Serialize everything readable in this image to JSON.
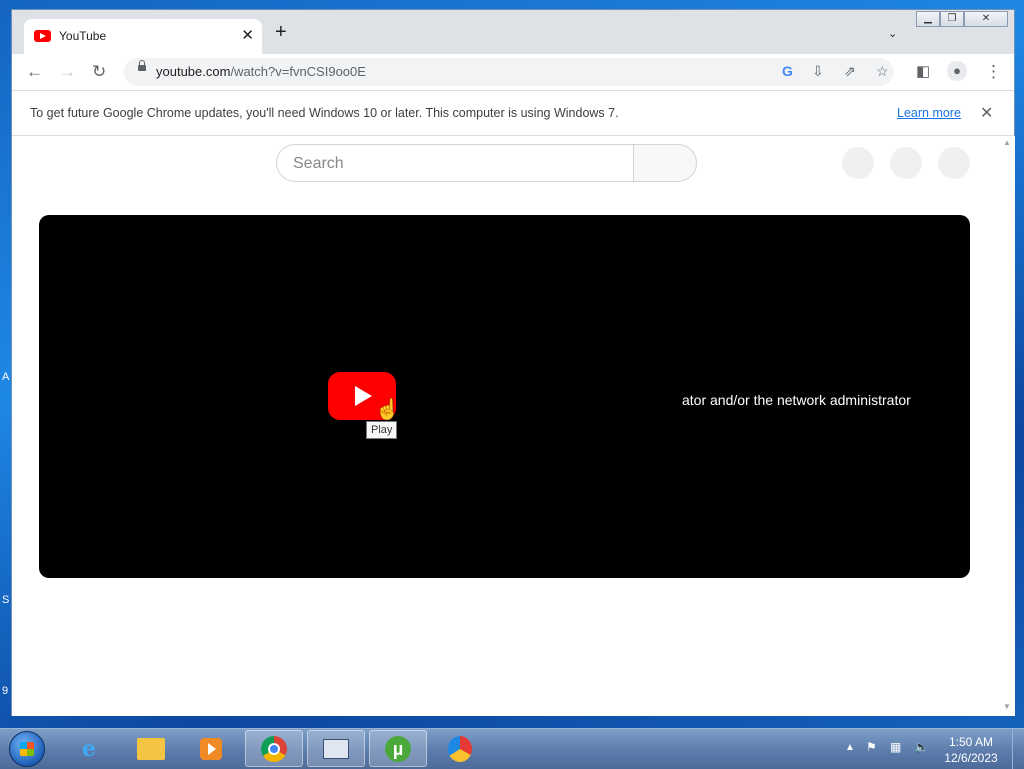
{
  "desktop": {
    "edge_letters": [
      "A",
      "S",
      "9"
    ]
  },
  "browser": {
    "tab": {
      "title": "YouTube"
    },
    "address_bar": {
      "url_host": "youtube.com",
      "url_path": "/watch?v=fvnCSI9oo0E"
    },
    "infobar": {
      "message": "To get future Google Chrome updates, you'll need Windows 10 or later. This computer is using Windows 7.",
      "link_label": "Learn more"
    }
  },
  "page": {
    "search_placeholder": "Search",
    "player": {
      "play_tooltip": "Play",
      "error_message": "ator and/or the network administrator"
    }
  },
  "taskbar": {
    "clock_time": "1:50 AM",
    "clock_date": "12/6/2023"
  },
  "colors": {
    "youtube_red": "#ff0000",
    "link_blue": "#1a73e8",
    "chrome_frame": "#dee1e6"
  }
}
